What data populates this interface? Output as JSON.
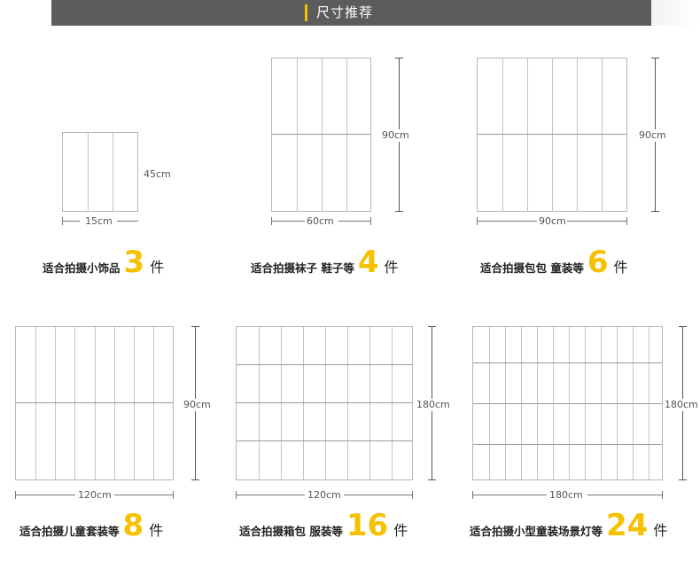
{
  "header": {
    "title": "尺寸推荐"
  },
  "sizes": [
    {
      "width_label": "15cm",
      "height_label": "45cm",
      "caption": "适合拍摄小饰品",
      "count": "3",
      "unit": "件"
    },
    {
      "width_label": "60cm",
      "height_label": "90cm",
      "caption": "适合拍摄袜子 鞋子等",
      "count": "4",
      "unit": "件"
    },
    {
      "width_label": "90cm",
      "height_label": "90cm",
      "caption": "适合拍摄包包 童装等",
      "count": "6",
      "unit": "件"
    },
    {
      "width_label": "120cm",
      "height_label": "90cm",
      "caption": "适合拍摄儿童套装等",
      "count": "8",
      "unit": "件"
    },
    {
      "width_label": "120cm",
      "height_label": "180cm",
      "caption": "适合拍摄箱包 服装等",
      "count": "16",
      "unit": "件"
    },
    {
      "width_label": "180cm",
      "height_label": "180cm",
      "caption": "适合拍摄小型童装场景灯等",
      "count": "24",
      "unit": "件"
    }
  ],
  "colors": {
    "accent": "#f6c100",
    "header_bg": "#5c5c5c",
    "grid_line": "#b7b7b7"
  }
}
